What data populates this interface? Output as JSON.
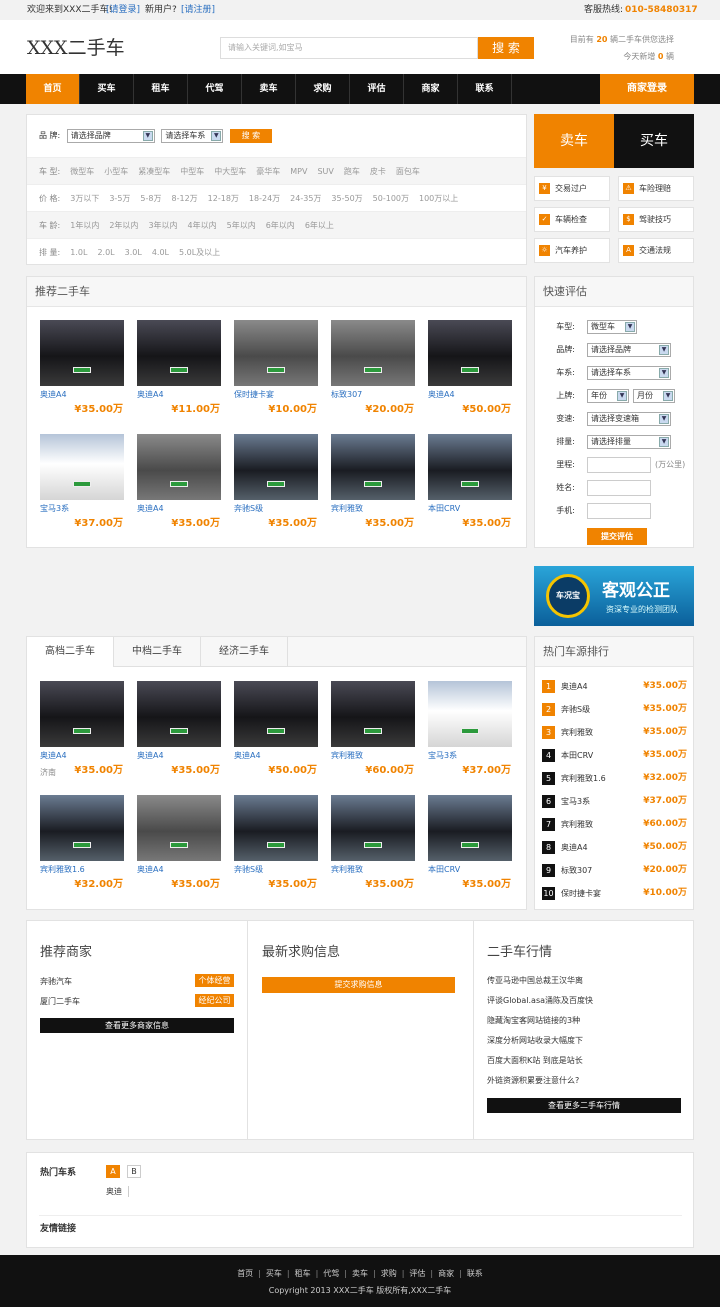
{
  "topbar": {
    "welcome": "欢迎来到XXX二手车!",
    "login": "[请登录]",
    "newuser": "新用户?",
    "register": "[请注册]",
    "hotline_label": "客服热线:",
    "hotline": "010-58480317"
  },
  "header": {
    "logo": "XXX二手车",
    "search_placeholder": "请输入关键词,如宝马",
    "search_btn": "搜 索",
    "stat1_pre": "目前有",
    "stat1_num": "20",
    "stat1_post": "辆二手车供您选择",
    "stat2_pre": "今天新增",
    "stat2_num": "0",
    "stat2_post": "辆"
  },
  "nav": {
    "items": [
      "首页",
      "买车",
      "租车",
      "代驾",
      "卖车",
      "求购",
      "评估",
      "商家",
      "联系"
    ],
    "login": "商家登录"
  },
  "filter": {
    "brand_label": "品 牌:",
    "brand_sel": "请选择品牌",
    "series_sel": "请选择车系",
    "search_btn": "搜 索",
    "rows": [
      {
        "label": "车 型:",
        "items": [
          "微型车",
          "小型车",
          "紧凑型车",
          "中型车",
          "中大型车",
          "豪华车",
          "MPV",
          "SUV",
          "跑车",
          "皮卡",
          "面包车"
        ]
      },
      {
        "label": "价 格:",
        "items": [
          "3万以下",
          "3-5万",
          "5-8万",
          "8-12万",
          "12-18万",
          "18-24万",
          "24-35万",
          "35-50万",
          "50-100万",
          "100万以上"
        ]
      },
      {
        "label": "车 龄:",
        "items": [
          "1年以内",
          "2年以内",
          "3年以内",
          "4年以内",
          "5年以内",
          "6年以内",
          "6年以上"
        ]
      },
      {
        "label": "排 量:",
        "items": [
          "1.0L",
          "2.0L",
          "3.0L",
          "4.0L",
          "5.0L及以上"
        ]
      }
    ]
  },
  "sidetabs": {
    "sell": "卖车",
    "buy": "买车",
    "links": [
      "交易过户",
      "车险理赔",
      "车辆检查",
      "驾驶技巧",
      "汽车养护",
      "交通法规"
    ]
  },
  "recommend": {
    "title": "推荐二手车",
    "cars": [
      {
        "name": "奥迪A4",
        "price": "¥35.00万"
      },
      {
        "name": "奥迪A4",
        "price": "¥11.00万"
      },
      {
        "name": "保时捷卡宴",
        "price": "¥10.00万"
      },
      {
        "name": "标致307",
        "price": "¥20.00万"
      },
      {
        "name": "奥迪A4",
        "price": "¥50.00万"
      },
      {
        "name": "宝马3系",
        "price": "¥37.00万"
      },
      {
        "name": "奥迪A4",
        "price": "¥35.00万"
      },
      {
        "name": "奔驰S级",
        "price": "¥35.00万"
      },
      {
        "name": "宾利雅致",
        "price": "¥35.00万"
      },
      {
        "name": "本田CRV",
        "price": "¥35.00万"
      }
    ]
  },
  "evaluate": {
    "title": "快速评估",
    "rows": [
      {
        "label": "车型:",
        "sel": [
          "微型车"
        ]
      },
      {
        "label": "品牌:",
        "sel": [
          "请选择品牌"
        ]
      },
      {
        "label": "车系:",
        "sel": [
          "请选择车系"
        ]
      },
      {
        "label": "上牌:",
        "sel": [
          "年份",
          "月份"
        ]
      },
      {
        "label": "变速:",
        "sel": [
          "请选择变速箱"
        ]
      },
      {
        "label": "排量:",
        "sel": [
          "请选择排量"
        ]
      }
    ],
    "mileage": "里程:",
    "mileage_unit": "(万公里)",
    "name": "姓名:",
    "phone": "手机:",
    "submit": "提交评估"
  },
  "banner": {
    "logo": "车况宝",
    "title": "客观公正",
    "sub": "资深专业的检测团队"
  },
  "gradeTabs": [
    "高档二手车",
    "中档二手车",
    "经济二手车"
  ],
  "grade": {
    "cars": [
      {
        "name": "奥迪A4",
        "price": "¥35.00万",
        "loc": "济南"
      },
      {
        "name": "奥迪A4",
        "price": "¥35.00万",
        "loc": ""
      },
      {
        "name": "奥迪A4",
        "price": "¥50.00万",
        "loc": ""
      },
      {
        "name": "宾利雅致",
        "price": "¥60.00万",
        "loc": ""
      },
      {
        "name": "宝马3系",
        "price": "¥37.00万",
        "loc": ""
      },
      {
        "name": "宾利雅致1.6",
        "price": "¥32.00万",
        "loc": ""
      },
      {
        "name": "奥迪A4",
        "price": "¥35.00万",
        "loc": ""
      },
      {
        "name": "奔驰S级",
        "price": "¥35.00万",
        "loc": ""
      },
      {
        "name": "宾利雅致",
        "price": "¥35.00万",
        "loc": ""
      },
      {
        "name": "本田CRV",
        "price": "¥35.00万",
        "loc": ""
      }
    ]
  },
  "hot": {
    "title": "热门车源排行",
    "items": [
      {
        "n": "1",
        "name": "奥迪A4",
        "price": "¥35.00万"
      },
      {
        "n": "2",
        "name": "奔驰S级",
        "price": "¥35.00万"
      },
      {
        "n": "3",
        "name": "宾利雅致",
        "price": "¥35.00万"
      },
      {
        "n": "4",
        "name": "本田CRV",
        "price": "¥35.00万"
      },
      {
        "n": "5",
        "name": "宾利雅致1.6",
        "price": "¥32.00万"
      },
      {
        "n": "6",
        "name": "宝马3系",
        "price": "¥37.00万"
      },
      {
        "n": "7",
        "name": "宾利雅致",
        "price": "¥60.00万"
      },
      {
        "n": "8",
        "name": "奥迪A4",
        "price": "¥50.00万"
      },
      {
        "n": "9",
        "name": "标致307",
        "price": "¥20.00万"
      },
      {
        "n": "10",
        "name": "保时捷卡宴",
        "price": "¥10.00万"
      }
    ]
  },
  "merchants": {
    "title": "推荐商家",
    "items": [
      {
        "name": "奔驰汽车",
        "tag": "个体经营"
      },
      {
        "name": "厦门二手车",
        "tag": "经纪公司"
      }
    ],
    "more": "查看更多商家信息"
  },
  "wanted": {
    "title": "最新求购信息",
    "btn": "提交求购信息"
  },
  "market": {
    "title": "二手车行情",
    "items": [
      "传亚马逊中国总裁王汉华离",
      "评谈Global.asa涌陈及百度快",
      "隐藏淘宝客网站链接的3种",
      "深度分析网站收录大幅度下",
      "百度大面积K站 到底是站长",
      "外链资源积累要注意什么?"
    ],
    "more": "查看更多二手车行情"
  },
  "hotcars": {
    "title": "热门车系",
    "letters": [
      "A",
      "B"
    ],
    "item": "奥迪"
  },
  "friends": {
    "title": "友情链接"
  },
  "footer": {
    "links": [
      "首页",
      "买车",
      "租车",
      "代驾",
      "卖车",
      "求购",
      "评估",
      "商家",
      "联系"
    ],
    "copyright": "Copyright 2013 XXX二手车 版权所有,XXX二手车"
  },
  "colors": {
    "accent": "#f08300",
    "dark": "#111111",
    "link": "#2a6fc0"
  }
}
